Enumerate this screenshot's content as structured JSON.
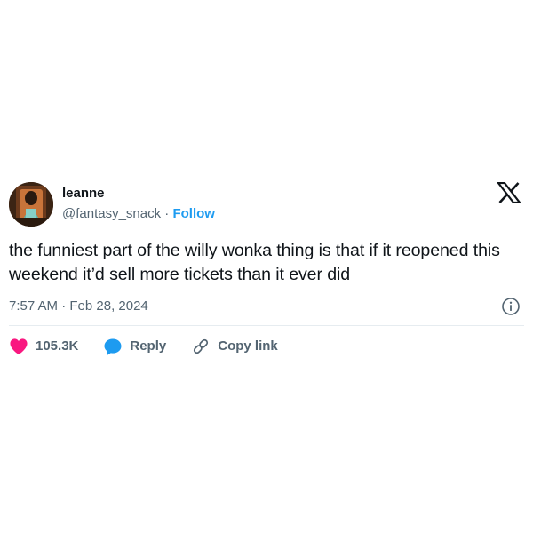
{
  "author": {
    "display_name": "leanne",
    "handle": "@fantasy_snack",
    "separator": "·",
    "follow_label": "Follow",
    "avatar_icon": "profile-photo"
  },
  "tweet": {
    "text": "the funniest part of the willy wonka thing is that if it reopened this weekend it’d sell more tickets than it ever did",
    "timestamp": "7:57 AM · Feb 28, 2024"
  },
  "actions": {
    "likes_count": "105.3K",
    "reply_label": "Reply",
    "copy_link_label": "Copy link"
  },
  "icons": {
    "brand": "x-logo-icon",
    "info": "info-icon",
    "like": "heart-icon",
    "reply": "speech-bubble-icon",
    "copy": "link-icon"
  },
  "colors": {
    "text_primary": "#0f1419",
    "text_secondary": "#536471",
    "link_blue": "#1d9bf0",
    "like_pink": "#f91880",
    "divider": "#e6ecf0"
  }
}
